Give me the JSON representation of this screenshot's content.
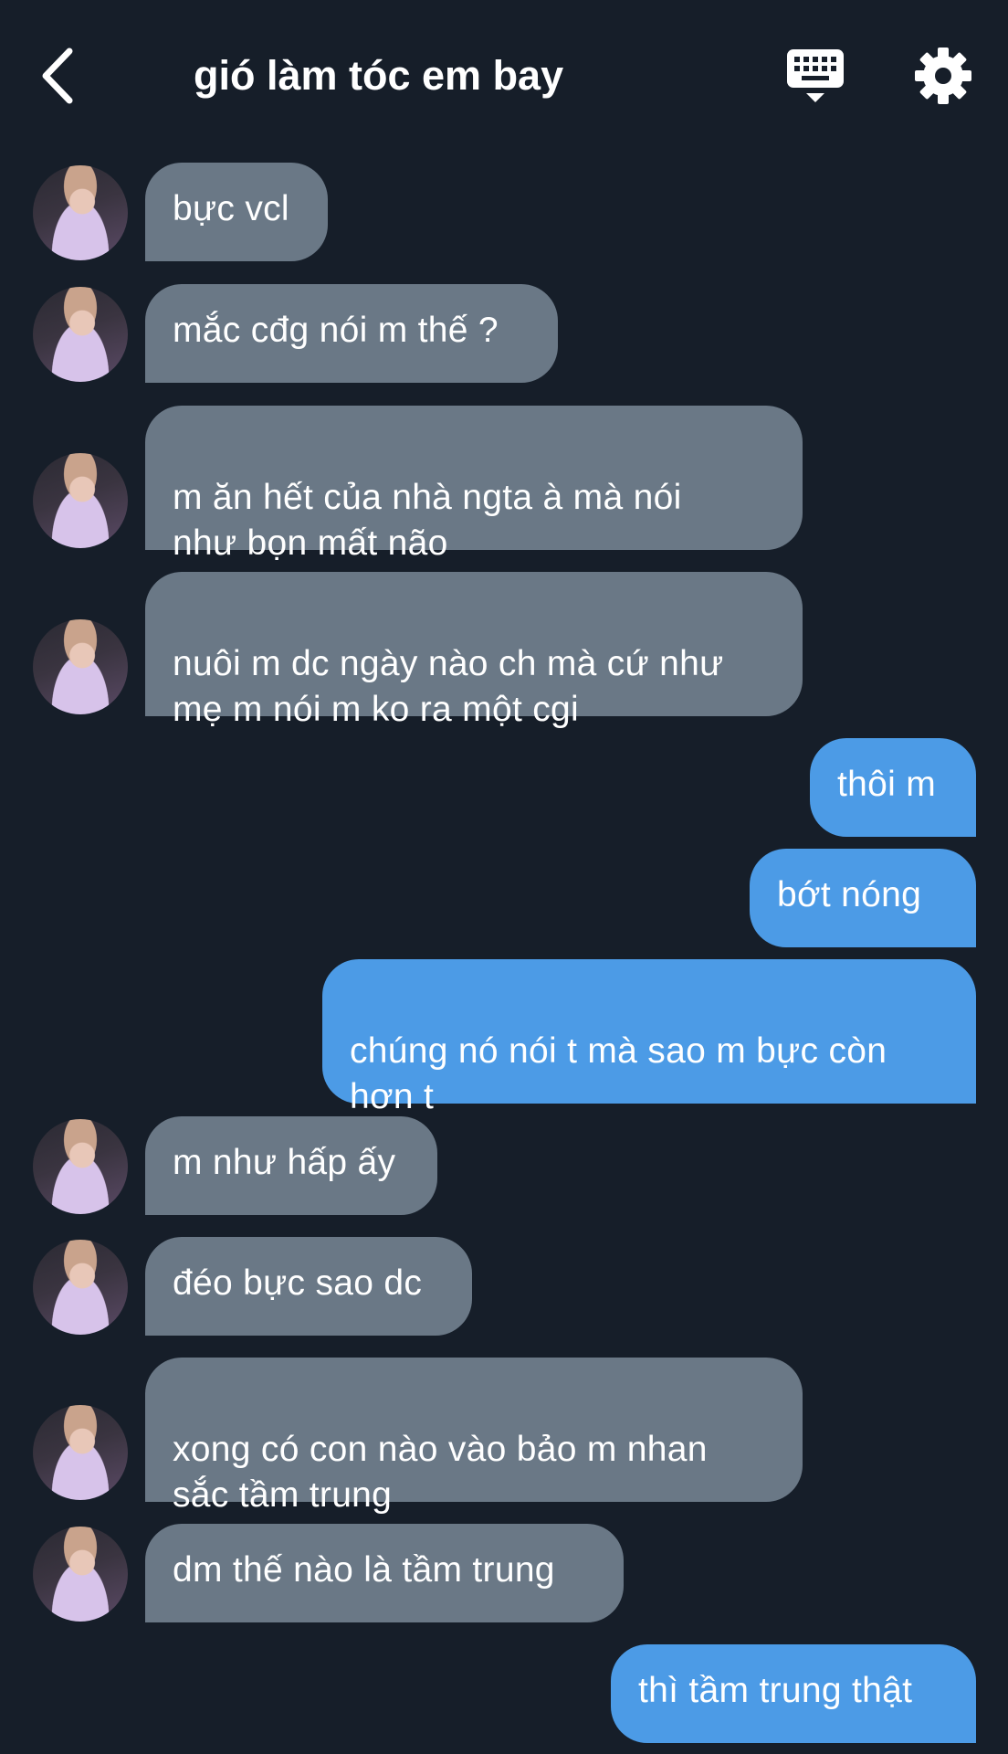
{
  "header": {
    "title": "gió làm tóc em bay",
    "back_icon": "chevron-left-icon",
    "keyboard_icon": "keyboard-icon",
    "settings_icon": "gear-icon"
  },
  "colors": {
    "background": "#161e29",
    "incoming_bubble": "#6a7886",
    "outgoing_bubble": "#4c9be6"
  },
  "messages": [
    {
      "side": "in",
      "text": "bực vcl"
    },
    {
      "side": "in",
      "text": "mắc cđg nói m thế ?"
    },
    {
      "side": "in",
      "text": "m ăn hết của nhà ngta à mà nói\nnhư bọn mất não"
    },
    {
      "side": "in",
      "text": "nuôi m dc ngày nào ch mà cứ như\nmẹ m nói m ko ra một cgi"
    },
    {
      "side": "out",
      "text": "thôi m"
    },
    {
      "side": "out",
      "text": "bớt nóng"
    },
    {
      "side": "out",
      "text": "chúng nó nói t mà sao m bực còn\nhơn t"
    },
    {
      "side": "in",
      "text": "m như hấp ấy"
    },
    {
      "side": "in",
      "text": "đéo bực sao dc"
    },
    {
      "side": "in",
      "text": "xong có con nào vào bảo m nhan\nsắc tầm trung"
    },
    {
      "side": "in",
      "text": "dm thế nào là tầm trung"
    },
    {
      "side": "out",
      "text": "thì tầm trung thật"
    }
  ]
}
